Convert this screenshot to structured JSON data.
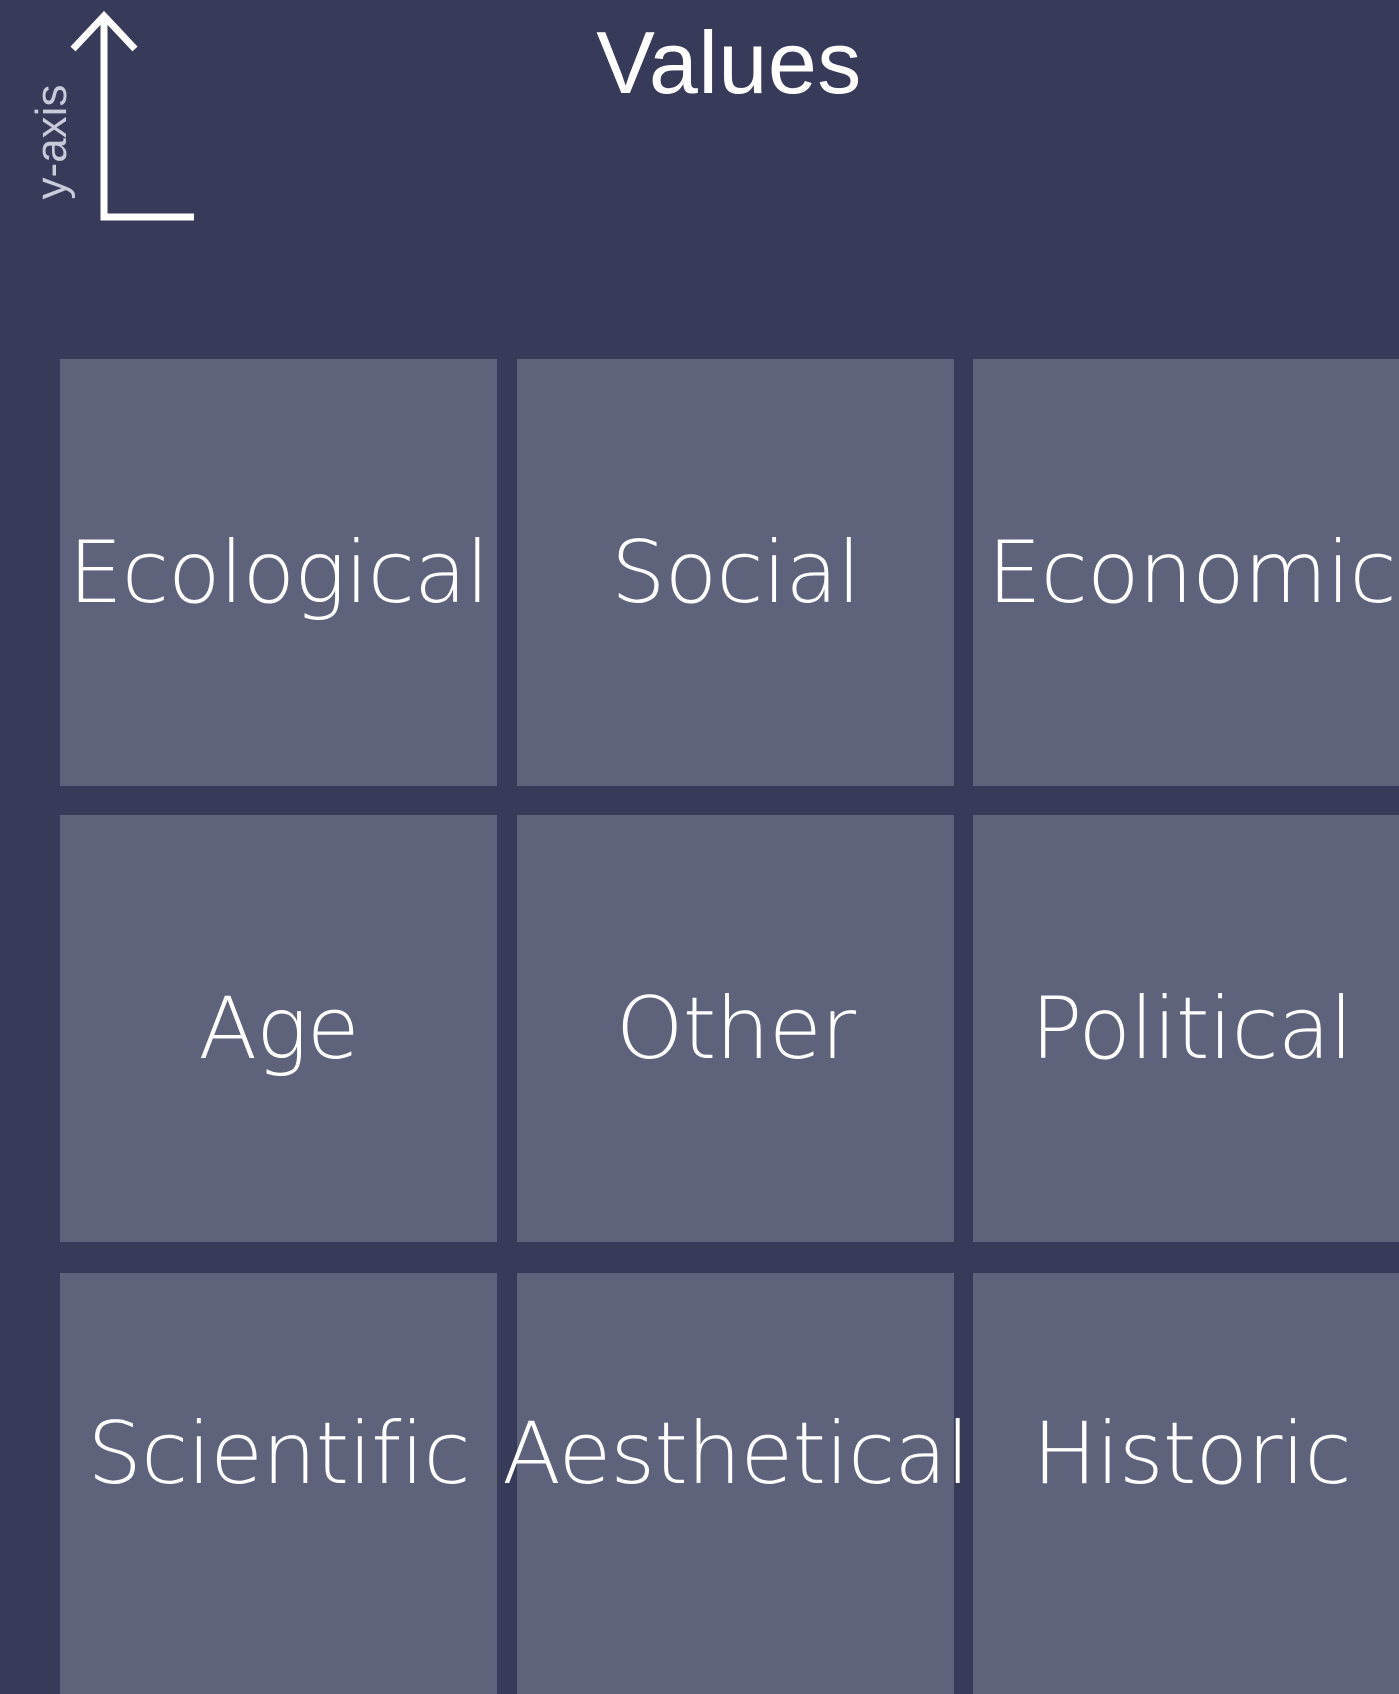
{
  "header": {
    "title": "Values",
    "axis_label": "y-axis"
  },
  "grid": {
    "tiles": [
      {
        "label": "Ecological"
      },
      {
        "label": "Social"
      },
      {
        "label": "Economic"
      },
      {
        "label": "Age"
      },
      {
        "label": "Other"
      },
      {
        "label": "Political"
      },
      {
        "label": "Scientific"
      },
      {
        "label": "Aesthetical"
      },
      {
        "label": "Historic"
      }
    ]
  },
  "colors": {
    "background": "#373a58",
    "tile": "#5e627b",
    "text": "#ffffff"
  }
}
